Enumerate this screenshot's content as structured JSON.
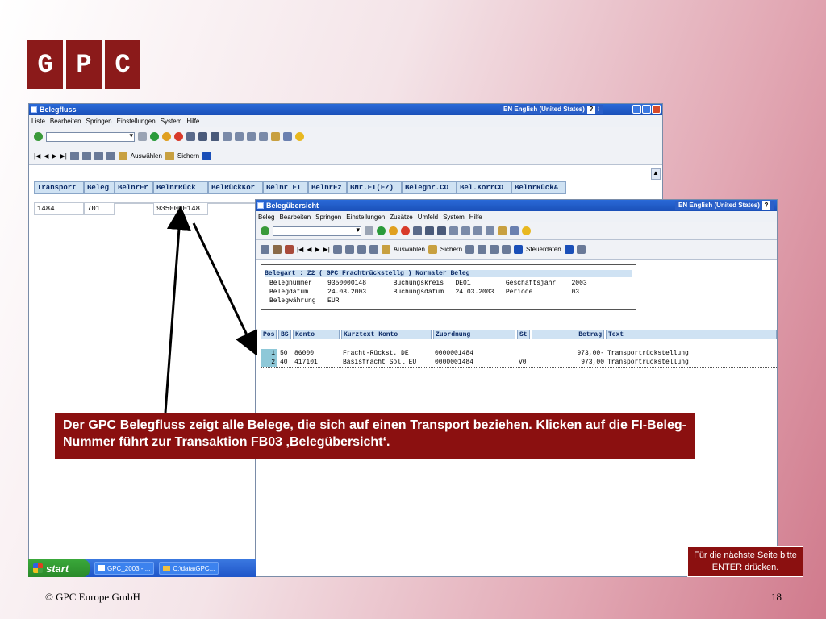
{
  "logo": [
    "G",
    "P",
    "C"
  ],
  "back_window": {
    "title": "Belegfluss",
    "language": "EN English (United States)",
    "menu": [
      "Liste",
      "Bearbeiten",
      "Springen",
      "Einstellungen",
      "System",
      "Hilfe"
    ],
    "toolbar2_labels": {
      "select": "Auswählen",
      "save": "Sichern"
    },
    "table": {
      "headers": [
        "Transport",
        "Beleg",
        "BelnrFr",
        "BelnrRück",
        "BelRückKor",
        "Belnr FI",
        "BelnrFz",
        "BNr.FI(FZ)",
        "Belegnr.CO",
        "Bel.KorrCO",
        "BelnrRückA"
      ],
      "row": [
        "1484",
        "701",
        "",
        "9350000148",
        "",
        "",
        "",
        "",
        "",
        "",
        ""
      ]
    }
  },
  "front_window": {
    "title": "Belegübersicht",
    "language": "EN English (United States)",
    "menu": [
      "Beleg",
      "Bearbeiten",
      "Springen",
      "Einstellungen",
      "Zusätze",
      "Umfeld",
      "System",
      "Hilfe"
    ],
    "toolbar2_labels": {
      "select": "Auswählen",
      "save": "Sichern",
      "control": "Steuerdaten"
    },
    "header_box": {
      "title_line": "Belegart : Z2 ( GPC Frachtrückstellg ) Normaler Beleg",
      "line1": "Belegnummer    9350000148       Buchungskreis   DE01         Geschäftsjahr    2003",
      "line2": "Belegdatum     24.03.2003       Buchungsdatum   24.03.2003   Periode          03",
      "line3": "Belegwährung   EUR"
    },
    "line_headers": [
      "Pos",
      "BS",
      "Konto",
      "Kurztext Konto",
      "Zuordnung",
      "St",
      "Betrag",
      "Text"
    ],
    "lines": [
      [
        "1",
        "50",
        "86000",
        "Fracht-Rückst. DE",
        "0000001484",
        "",
        "973,00-",
        "Transportrückstellung"
      ],
      [
        "2",
        "40",
        "417101",
        "Basisfracht Soll EU",
        "0000001484",
        "V0",
        "973,00",
        "Transportrückstellung"
      ]
    ]
  },
  "taskbar": {
    "start": "start",
    "tasks": [
      "GPC_2003 - ...",
      "C:\\data\\GPC..."
    ]
  },
  "callout_text": "Der GPC Belegfluss zeigt alle Belege, die sich auf einen Transport beziehen. Klicken auf die FI-Beleg-Nummer führt zur Transaktion FB03 ‚Belegübersicht‘.",
  "hint_text": "Für die nächste Seite bitte ENTER drücken.",
  "footer_left": "© GPC Europe GmbH",
  "footer_right": "18",
  "colors": {
    "brand_red": "#8b1a1a",
    "sap_blue": "#2a6ad8",
    "header_blue": "#cfe2f3"
  }
}
